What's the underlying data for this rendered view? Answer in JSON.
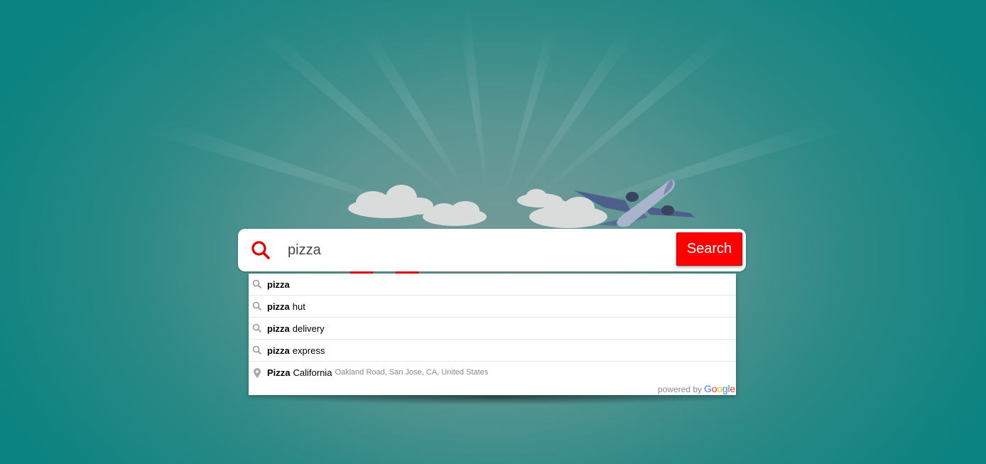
{
  "search": {
    "value": "pizza",
    "button_label": "Search"
  },
  "autocomplete": {
    "items": [
      {
        "icon": "search-icon",
        "match": "pizza",
        "rest": "",
        "secondary": ""
      },
      {
        "icon": "search-icon",
        "match": "pizza",
        "rest": "hut",
        "secondary": ""
      },
      {
        "icon": "search-icon",
        "match": "pizza",
        "rest": "delivery",
        "secondary": ""
      },
      {
        "icon": "search-icon",
        "match": "pizza",
        "rest": "express",
        "secondary": ""
      },
      {
        "icon": "map-pin-icon",
        "match": "Pizza",
        "rest": "California",
        "secondary": "Oakland Road, San Jose, CA, United States"
      }
    ],
    "powered_by": "powered by",
    "google_letters": [
      "G",
      "o",
      "o",
      "g",
      "l",
      "e"
    ]
  },
  "colors": {
    "accent": "#ff0000",
    "background": "#0b8380",
    "google": [
      "#4285f4",
      "#ea4335",
      "#fbbc05",
      "#4285f4",
      "#34a853",
      "#ea4335"
    ]
  }
}
